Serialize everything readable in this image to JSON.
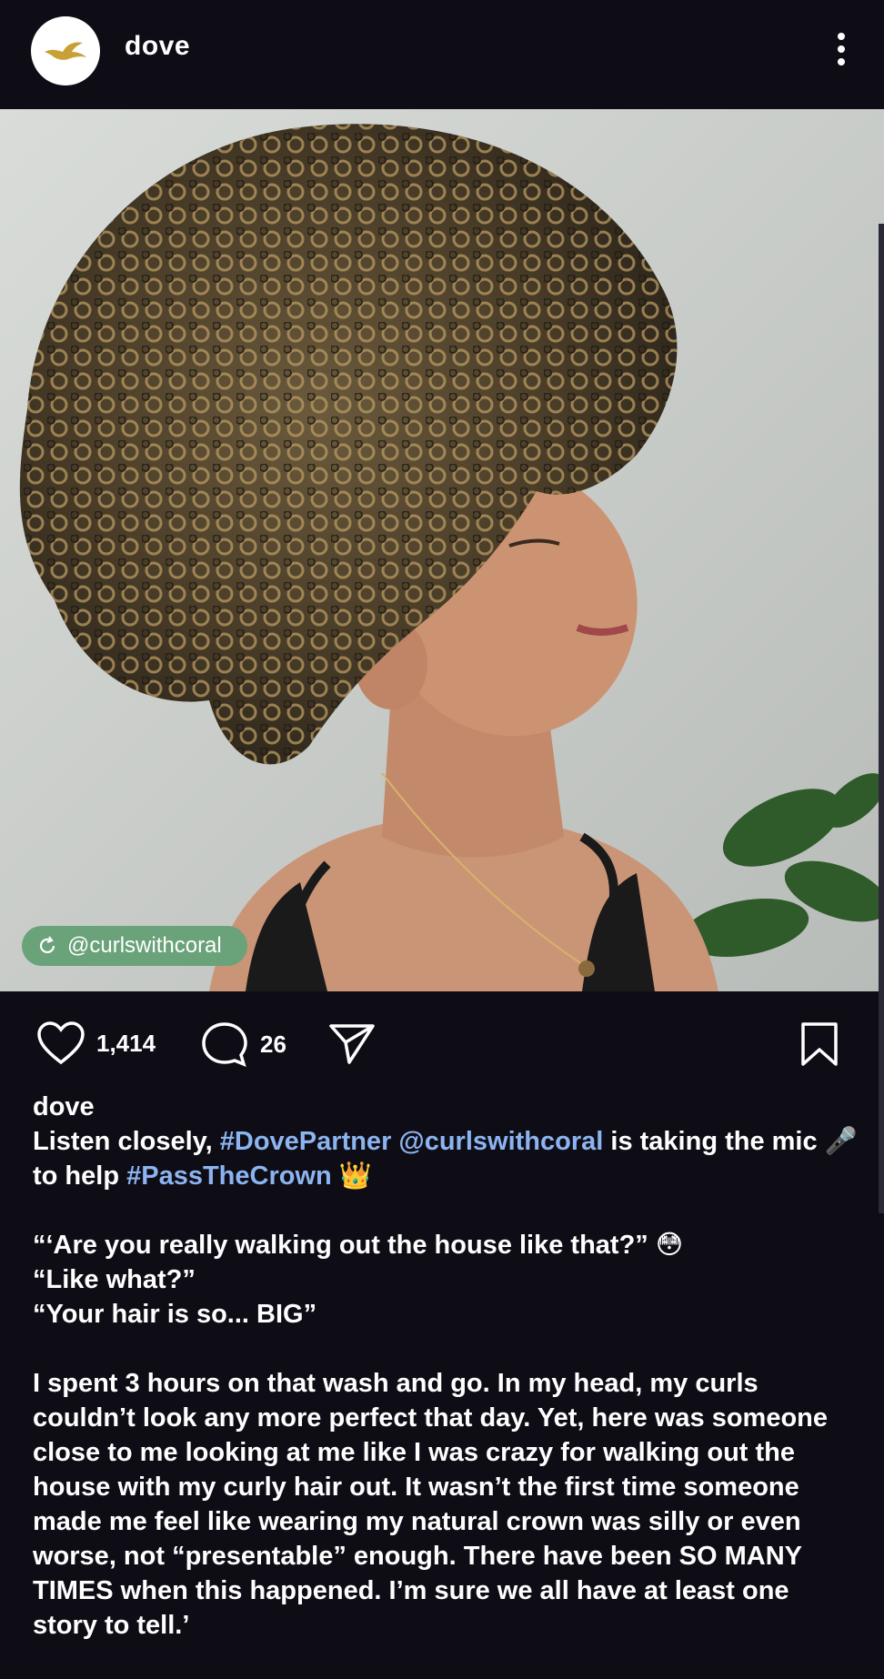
{
  "header": {
    "username": "dove"
  },
  "post": {
    "tagged_user": "@curlswithcoral",
    "likes": "1,414",
    "comments": "26"
  },
  "caption": {
    "author": "dove",
    "line1_pre": "Listen closely, ",
    "tag1": "#DovePartner",
    "space1": " ",
    "mention": "@curlswithcoral",
    "line1_post": " is taking the mic 🎤 to help ",
    "tag2": "#PassTheCrown",
    "crown": " 👑",
    "q1": "“‘Are you really walking out the house like that?” 😳",
    "q2": "“Like what?”",
    "q3": "“Your hair is so... BIG”",
    "para": "I spent 3 hours on that wash and go. In my head, my curls couldn’t look any more perfect that day. Yet, here was someone close to me looking at me like I was crazy for walking out the house with my curly hair out. It wasn’t the first time someone made me feel like wearing my natural crown was silly or even worse, not “presentable” enough. There have been SO MANY TIMES when this happened. I’m sure we all have at least one story to tell.’"
  },
  "colors": {
    "background": "#0e0d16",
    "hashtag": "#8cb4f0",
    "chip": "#6aa27a"
  }
}
